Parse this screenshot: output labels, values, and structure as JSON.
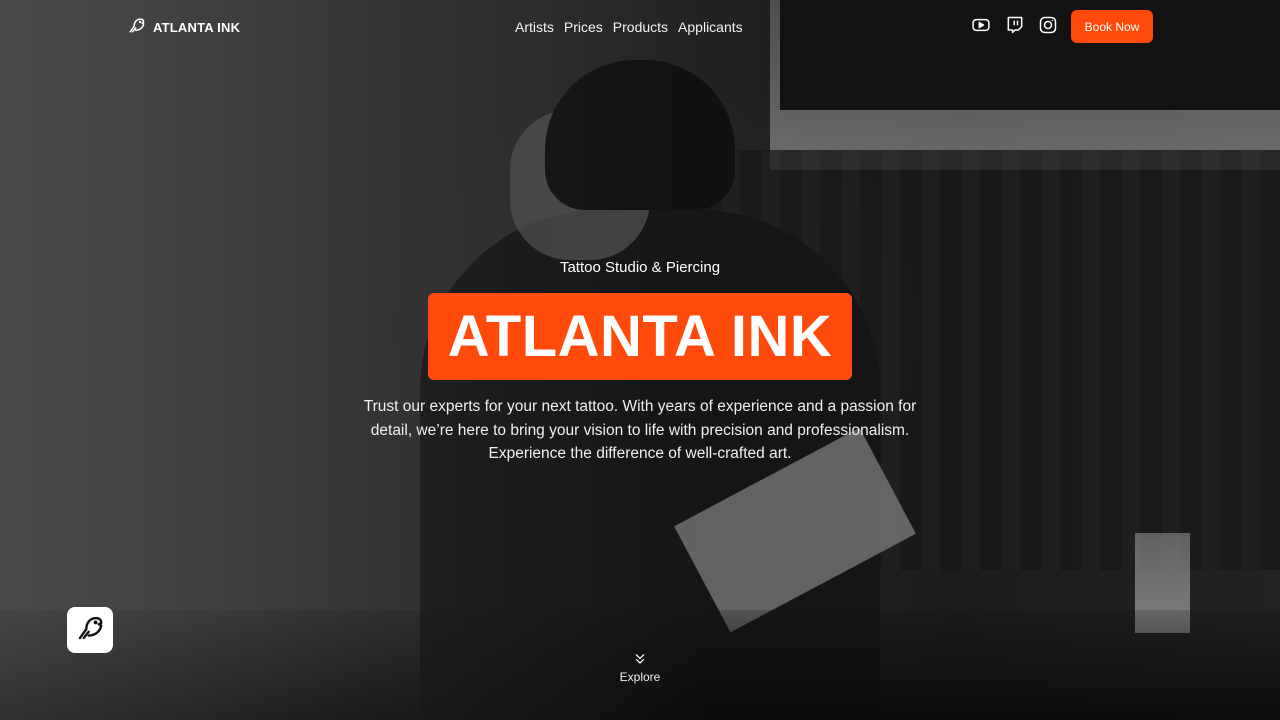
{
  "brand": {
    "name": "ATLANTA INK",
    "icon": "bird-logo-icon"
  },
  "nav": {
    "links": [
      {
        "label": "Artists"
      },
      {
        "label": "Prices"
      },
      {
        "label": "Products"
      },
      {
        "label": "Applicants"
      }
    ],
    "social": [
      {
        "icon": "youtube-icon"
      },
      {
        "icon": "twitch-icon"
      },
      {
        "icon": "instagram-icon"
      }
    ],
    "cta_label": "Book Now"
  },
  "hero": {
    "eyebrow": "Tattoo Studio & Piercing",
    "title": "ATLANTA INK",
    "tagline_line1": "Trust our experts for your next tattoo. With years of experience and a passion for",
    "tagline_line2": "detail, we’re here to bring your vision to life with precision and professionalism.",
    "tagline_line3": "Experience the difference of well-crafted art."
  },
  "explore": {
    "label": "Explore",
    "icon": "chevrons-down-icon"
  },
  "badge": {
    "icon": "bird-logo-icon"
  },
  "colors": {
    "accent": "#ff4a0c",
    "text": "#ffffff"
  }
}
